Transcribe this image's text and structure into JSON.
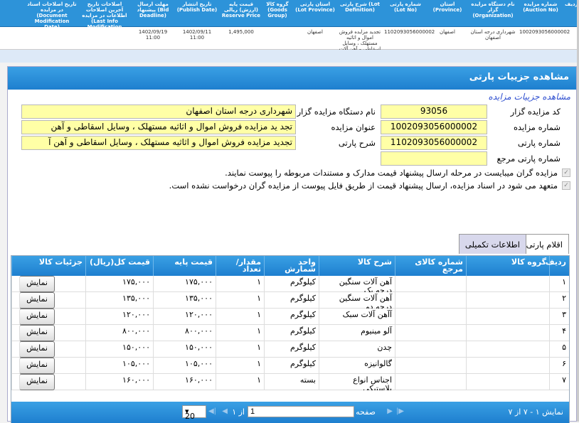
{
  "background": {
    "headers": [
      "ردیف",
      "شماره مزایده (Auction No)",
      "نام دستگاه مزایده گزار (Organization)",
      "استان (Province)",
      "شماره پارتی (Lot No)",
      "شرح پارتی (Lot Definition)",
      "استان پارتی (Lot Province)",
      "گروه کالا (Goods Group)",
      "قیمت پایه (ارزش) ریالی Reserve Price",
      "تاریخ انتشار (Publish Date)",
      "مهلت ارسال پیشنهاد (Bid Deadline)",
      "اصلاحات تاریخ آخرین اصلاحات اطلاعات در مزایده (Last Info Modification Date)",
      "تاریخ اصلاحات اسناد در مزایده (Document Modification Date)"
    ],
    "row": [
      "",
      "1002093056000002",
      "شهرداری درجه استان اصفهان",
      "اصفهان",
      "1102093056000002",
      "تجدید مزایده فروش اموال و اثاثیه مستهلک ، وسایل اسقاطی و آهن آلات",
      "اصفهان",
      "",
      "1,495,000",
      "1402/09/11 11:00",
      "1402/09/19 11:00",
      "",
      ""
    ]
  },
  "title": "مشاهده جزییات پارتی",
  "subtitle": "مشاهده جزییات مزایده",
  "form": {
    "auctioneer_code_label": "کد مزایده گزار",
    "auctioneer_code": "93056",
    "org_name_label": "نام دستگاه مزایده گزار",
    "org_name": "شهرداری درجه استان اصفهان",
    "auction_no_label": "شماره مزایده",
    "auction_no": "1002093056000002",
    "auction_title_label": "عنوان مزایده",
    "auction_title": "تجد ید مزایده فروش اموال و اثاثیه مستهلک ، وسایل اسقاطی و آهن",
    "lot_no_label": "شماره پارتی",
    "lot_no": "1102093056000002",
    "lot_desc_label": "شرح پارتی",
    "lot_desc": "تجدید مزایده فروش اموال و اثاثیه مستهلک ، وسایل اسقاطی و آهن آ",
    "ref_lot_label": "شماره پارتی مرجع",
    "ref_lot": ""
  },
  "notes": [
    "مزایده گران میبایست در مرحله ارسال پیشنهاد قیمت مدارک و مستندات مربوطه را پیوست نمایند.",
    "متعهد می شود در اسناد مزایده، ارسال پیشنهاد قیمت از طریق فایل پیوست از مزایده گران درخواست نشده است."
  ],
  "tabs": {
    "items": "اقلام پارتی",
    "extra": "اطلاعات تکمیلی"
  },
  "grid": {
    "headers": [
      "ردیف",
      "گروه کالا",
      "شماره کالای مرجع",
      "شرح کالا",
      "واحد شمارش",
      "مقدار/تعداد",
      "قیمت پایه",
      "قیمت کل(ریال)",
      "جزئیات کالا"
    ],
    "button_label": "نمایش",
    "rows": [
      {
        "n": "۱",
        "desc": "آهن آلات سنگین درجه یک",
        "unit": "کیلوگرم",
        "qty": "۱",
        "base": "۱۷۵,۰۰۰",
        "total": "۱۷۵,۰۰۰"
      },
      {
        "n": "۲",
        "desc": "آهن آلات سنگین درجه دو",
        "unit": "کیلوگرم",
        "qty": "۱",
        "base": "۱۳۵,۰۰۰",
        "total": "۱۳۵,۰۰۰"
      },
      {
        "n": "۳",
        "desc": "آآهن  آلات سبک",
        "unit": "کیلوگرم",
        "qty": "۱",
        "base": "۱۲۰,۰۰۰",
        "total": "۱۲۰,۰۰۰"
      },
      {
        "n": "۴",
        "desc": "آلو مینیوم",
        "unit": "کیلوگرم",
        "qty": "۱",
        "base": "۸۰۰,۰۰۰",
        "total": "۸۰۰,۰۰۰"
      },
      {
        "n": "۵",
        "desc": "چدن",
        "unit": "کیلوگرم",
        "qty": "۱",
        "base": "۱۵۰,۰۰۰",
        "total": "۱۵۰,۰۰۰"
      },
      {
        "n": "۶",
        "desc": "گالوانیزه",
        "unit": "کیلوگرم",
        "qty": "۱",
        "base": "۱۰۵,۰۰۰",
        "total": "۱۰۵,۰۰۰"
      },
      {
        "n": "۷",
        "desc": "اجناس انواع پلاستیکی",
        "unit": "بسته",
        "qty": "۱",
        "base": "۱۶۰,۰۰۰",
        "total": "۱۶۰,۰۰۰"
      }
    ]
  },
  "pager": {
    "showing": "نمایش ۱ - ۷ از ۷",
    "page_label": "صفحه",
    "page_value": "1",
    "of_label": "از ۱",
    "page_size": "20"
  }
}
